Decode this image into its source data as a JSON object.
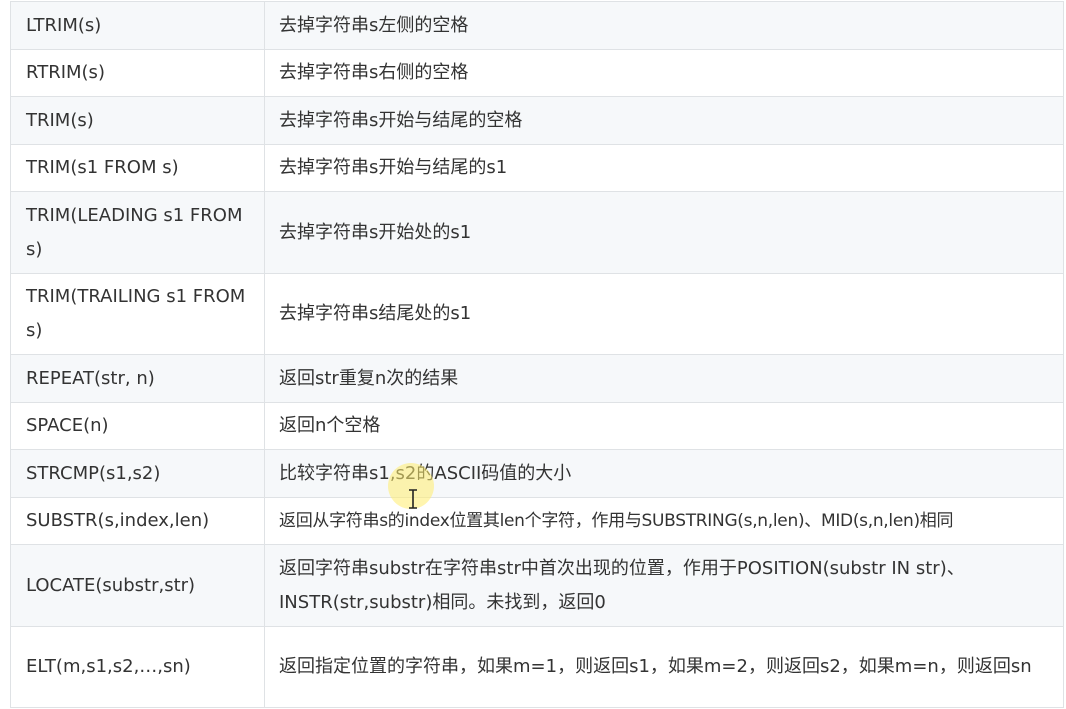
{
  "rows": [
    {
      "func": "LTRIM(s)",
      "desc": "去掉字符串s左侧的空格"
    },
    {
      "func": "RTRIM(s)",
      "desc": "去掉字符串s右侧的空格"
    },
    {
      "func": "TRIM(s)",
      "desc": "去掉字符串s开始与结尾的空格"
    },
    {
      "func": "TRIM(s1 FROM s)",
      "desc": "去掉字符串s开始与结尾的s1"
    },
    {
      "func": "TRIM(LEADING s1 FROM s)",
      "desc": "去掉字符串s开始处的s1"
    },
    {
      "func": "TRIM(TRAILING s1 FROM s)",
      "desc": "去掉字符串s结尾处的s1"
    },
    {
      "func": "REPEAT(str, n)",
      "desc": "返回str重复n次的结果"
    },
    {
      "func": "SPACE(n)",
      "desc": "返回n个空格"
    },
    {
      "func": "STRCMP(s1,s2)",
      "desc": "比较字符串s1,s2的ASCII码值的大小"
    },
    {
      "func": "SUBSTR(s,index,len)",
      "desc": "返回从字符串s的index位置其len个字符，作用与SUBSTRING(s,n,len)、MID(s,n,len)相同"
    },
    {
      "func": "LOCATE(substr,str)",
      "desc": "返回字符串substr在字符串str中首次出现的位置，作用于POSITION(substr IN str)、INSTR(str,substr)相同。未找到，返回0"
    },
    {
      "func": "ELT(m,s1,s2,…,sn)",
      "desc": "返回指定位置的字符串，如果m=1，则返回s1，如果m=2，则返回s2，如果m=n，则返回sn"
    }
  ]
}
